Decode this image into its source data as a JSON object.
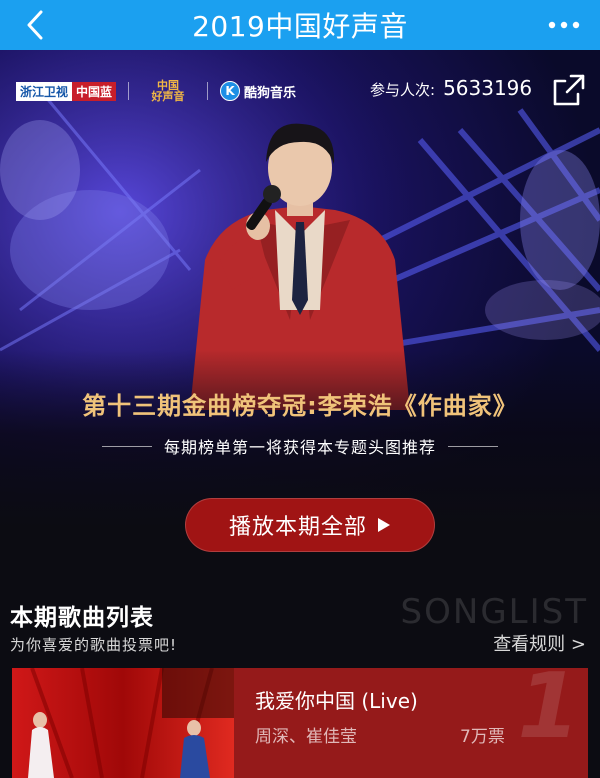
{
  "nav": {
    "title": "2019中国好声音",
    "back_icon": "chevron-left-icon",
    "more_icon": "more-dots-icon"
  },
  "banner": {
    "logos": {
      "zhejiang_part1": "浙江卫视",
      "zhejiang_part2": "中国蓝",
      "voice_line1": "中国",
      "voice_line2": "好声音",
      "kugou_letter": "K",
      "kugou_name": "酷狗音乐"
    },
    "participation_label": "参与人次:",
    "participation_count": "5633196",
    "share_icon": "share-external-icon",
    "title": "第十三期金曲榜夺冠:李荣浩《作曲家》",
    "subtitle": "每期榜单第一将获得本专题头图推荐",
    "play_all_label": "播放本期全部",
    "play_icon": "play-triangle-icon"
  },
  "songlist": {
    "title": "本期歌曲列表",
    "watermark": "SONGLIST",
    "subtitle": "为你喜爱的歌曲投票吧!",
    "rules_link": "查看规则 >",
    "songs": [
      {
        "name": "我爱你中国 (Live)",
        "artists": "周深、崔佳莹",
        "votes": "7万票",
        "rank": "1"
      }
    ]
  },
  "colors": {
    "nav_bg": "#1ba0f0",
    "accent_red": "#a01414",
    "card_red": "#951a1a",
    "gold_title": "#f0c37a"
  }
}
